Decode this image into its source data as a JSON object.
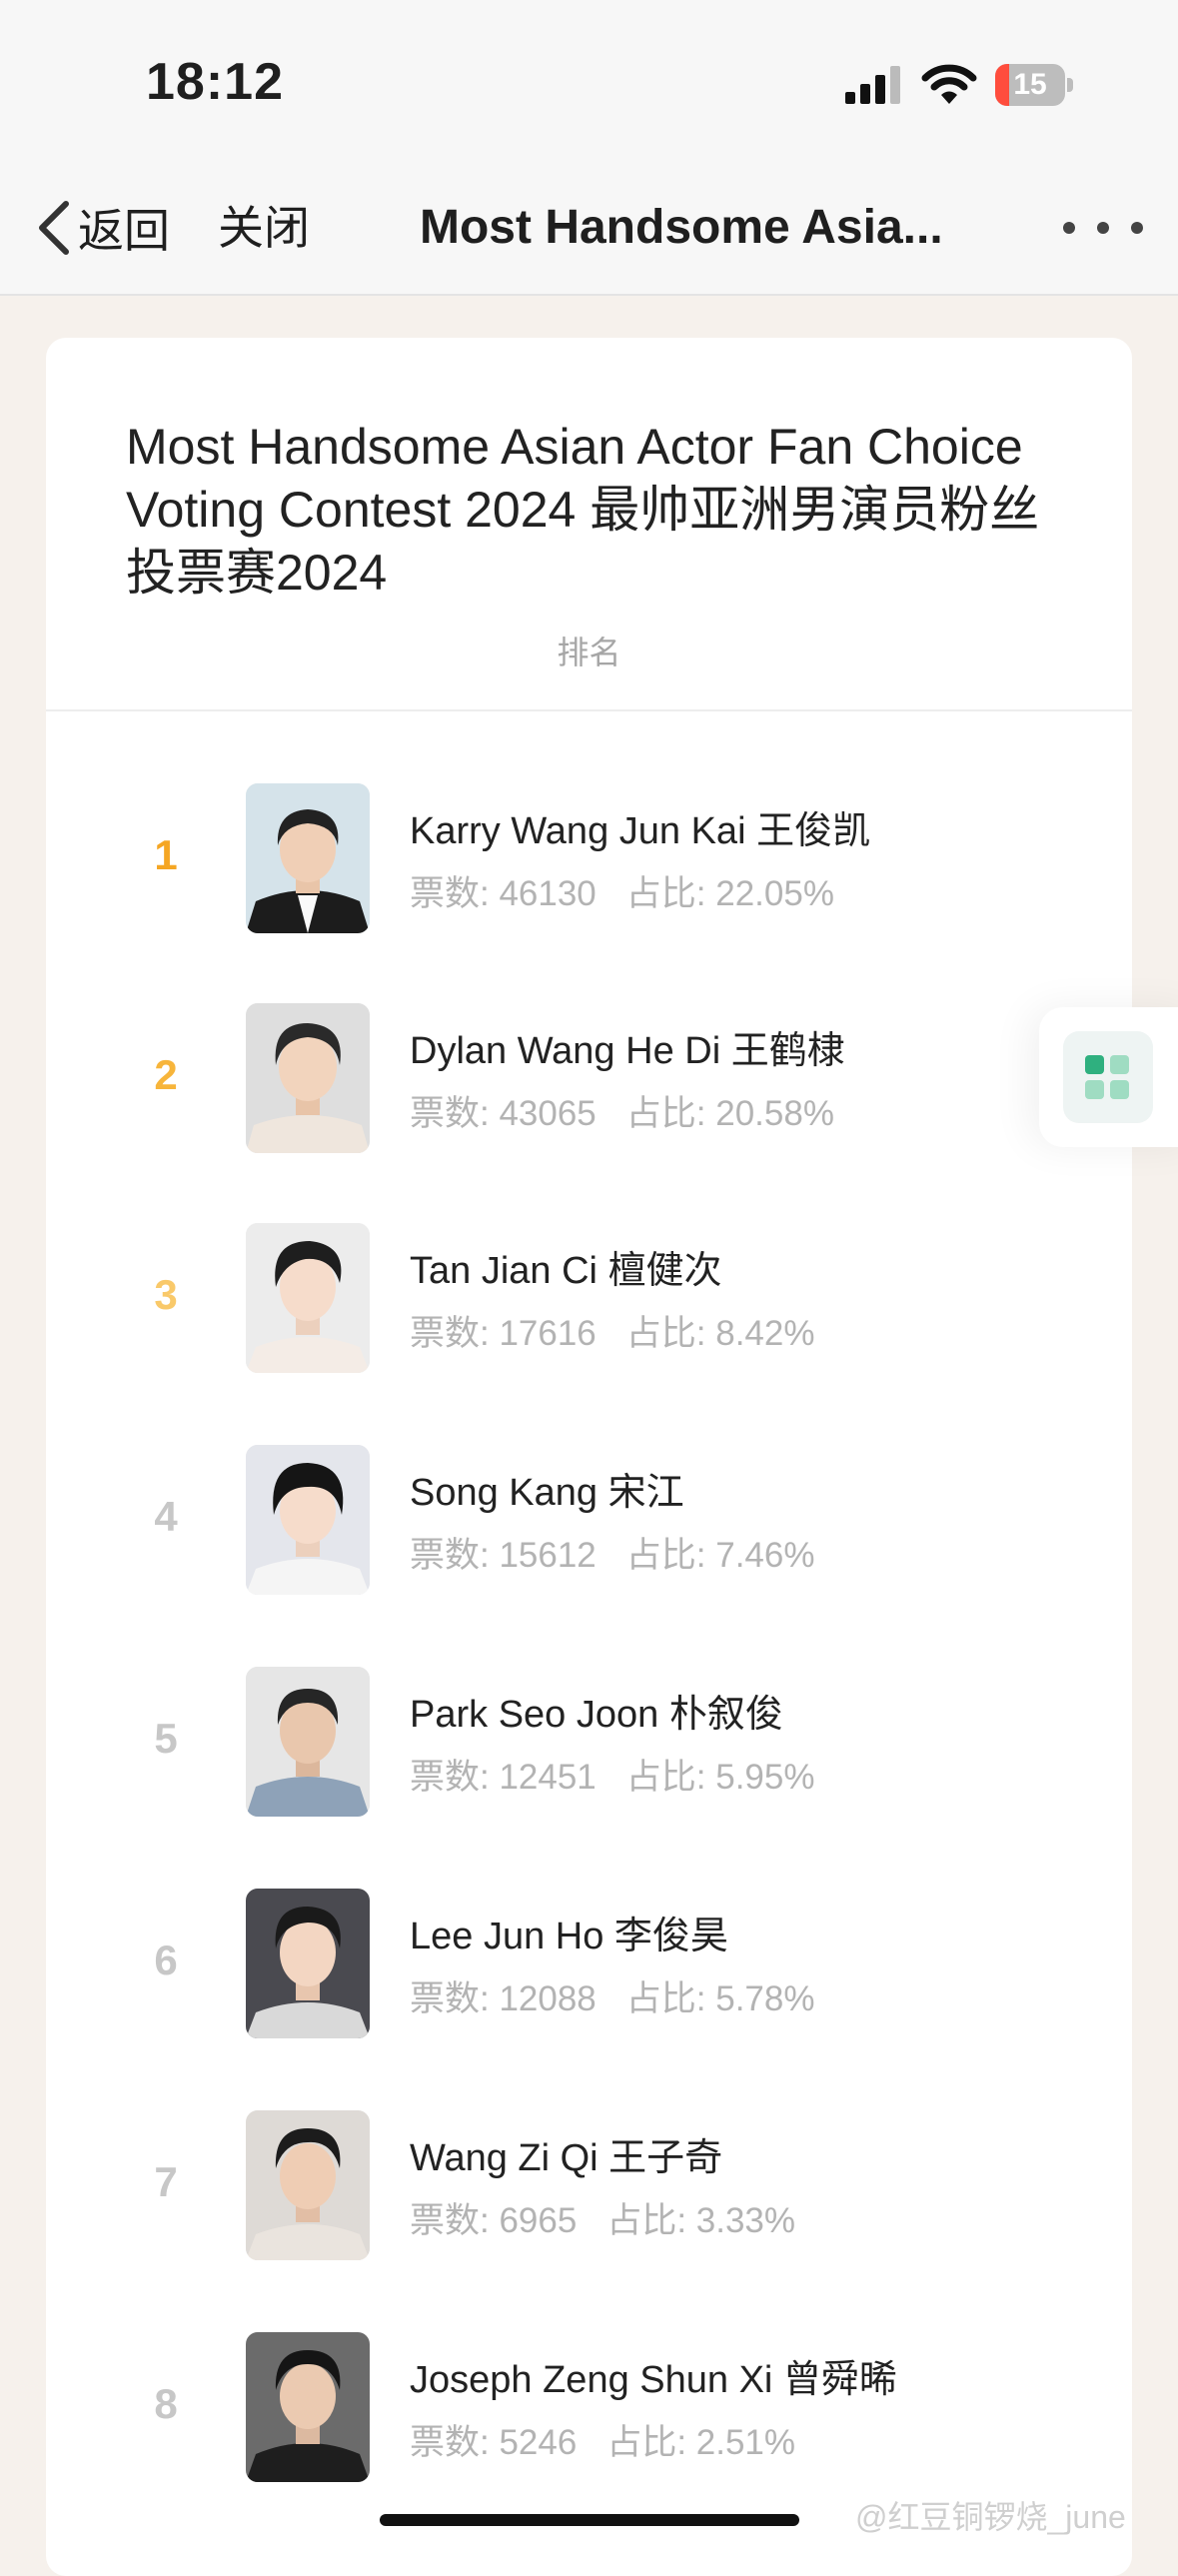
{
  "status_bar": {
    "time": "18:12",
    "battery": "15"
  },
  "nav": {
    "back_label": "返回",
    "close_label": "关闭",
    "title": "Most Handsome Asia..."
  },
  "contest": {
    "title": "Most Handsome Asian Actor Fan Choice Voting Contest 2024 最帅亚洲男演员粉丝投票赛2024",
    "subtitle": "排名"
  },
  "colors": {
    "rank1": "#f5a623",
    "rank2": "#f7b53b",
    "rank3": "#f9c96a",
    "rank_other": "#c7c7c7",
    "accent_green": "#3fb98a"
  },
  "ranking": [
    {
      "rank": "1",
      "name": "Karry Wang Jun Kai 王俊凯",
      "votes": "票数: 46130",
      "ratio": "占比: 22.05%"
    },
    {
      "rank": "2",
      "name": "Dylan Wang He Di 王鹤棣",
      "votes": "票数: 43065",
      "ratio": "占比: 20.58%"
    },
    {
      "rank": "3",
      "name": "Tan Jian Ci 檀健次",
      "votes": "票数: 17616",
      "ratio": "占比: 8.42%"
    },
    {
      "rank": "4",
      "name": "Song Kang 宋江",
      "votes": "票数: 15612",
      "ratio": "占比: 7.46%"
    },
    {
      "rank": "5",
      "name": "Park Seo Joon 朴叙俊",
      "votes": "票数: 12451",
      "ratio": "占比: 5.95%"
    },
    {
      "rank": "6",
      "name": "Lee Jun Ho 李俊昊",
      "votes": "票数: 12088",
      "ratio": "占比: 5.78%"
    },
    {
      "rank": "7",
      "name": "Wang Zi Qi 王子奇",
      "votes": "票数: 6965",
      "ratio": "占比: 3.33%"
    },
    {
      "rank": "8",
      "name": "Joseph Zeng Shun Xi 曾舜晞",
      "votes": "票数: 5246",
      "ratio": "占比: 2.51%"
    }
  ],
  "watermark": "@红豆铜锣烧_june"
}
